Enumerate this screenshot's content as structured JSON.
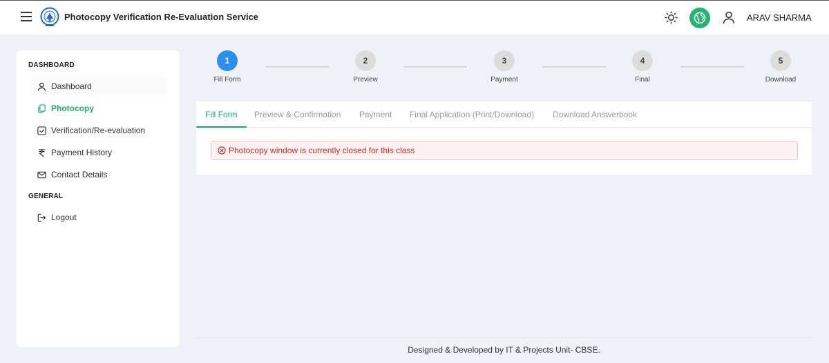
{
  "header": {
    "title": "Photocopy Verification Re-Evaluation Service",
    "user_name": "ARAV SHARMA",
    "icons": [
      "menu-icon",
      "cbse-logo",
      "sun-icon",
      "globe-icon",
      "user-icon"
    ],
    "accent_color": "#26b373"
  },
  "sidebar": {
    "section_dashboard": "DASHBOARD",
    "section_general": "GENERAL",
    "items": [
      {
        "label": "Dashboard",
        "icon": "user-icon"
      },
      {
        "label": "Photocopy",
        "icon": "copy-icon",
        "active": true
      },
      {
        "label": "Verification/Re-evaluation",
        "icon": "checkbox-icon"
      },
      {
        "label": "Payment History",
        "icon": "rupee-icon"
      },
      {
        "label": "Contact Details",
        "icon": "mail-icon"
      }
    ],
    "logout": {
      "label": "Logout",
      "icon": "logout-icon"
    }
  },
  "stepper": {
    "steps": [
      {
        "number": "1",
        "label": "Fill Form",
        "active": true
      },
      {
        "number": "2",
        "label": "Preview"
      },
      {
        "number": "3",
        "label": "Payment"
      },
      {
        "number": "4",
        "label": "Final"
      },
      {
        "number": "5",
        "label": "Download"
      }
    ],
    "active_color": "#2b8ff0"
  },
  "tabs": [
    {
      "label": "Fill Form",
      "active": true
    },
    {
      "label": "Preview & Confirmation"
    },
    {
      "label": "Payment"
    },
    {
      "label": "Final Application (Print/Download)"
    },
    {
      "label": "Download Answerbook"
    }
  ],
  "alert": {
    "message": "Photocopy window is currently closed for this class",
    "color": "#c53030"
  },
  "footer": {
    "text": "Designed & Developed by IT & Projects Unit- CBSE."
  }
}
